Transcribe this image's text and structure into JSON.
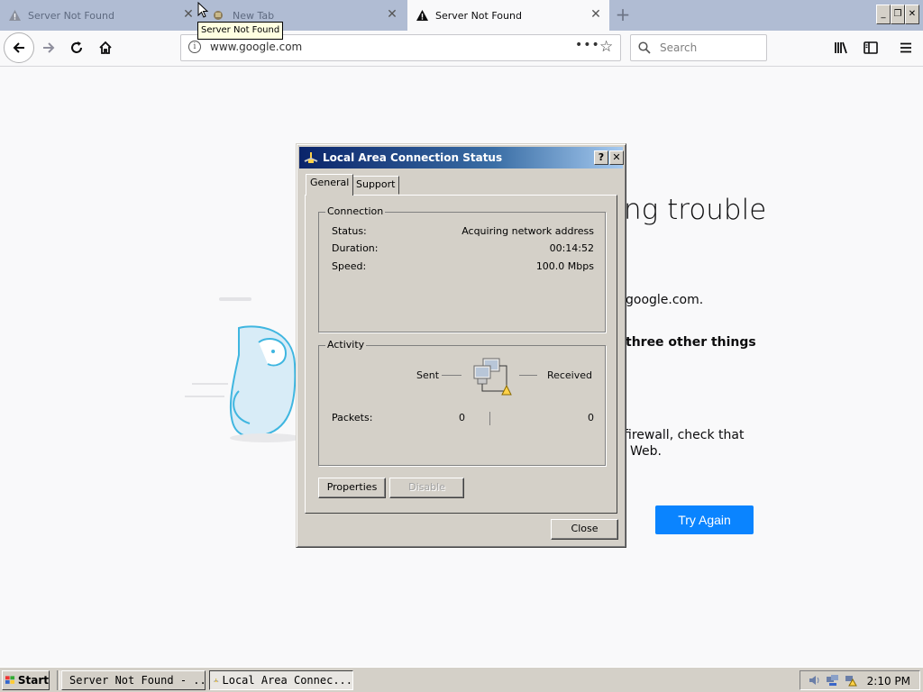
{
  "browser": {
    "tabs": [
      {
        "title": "Server Not Found",
        "state": "inactive"
      },
      {
        "title": "New Tab",
        "state": "inactive"
      },
      {
        "title": "Server Not Found",
        "state": "active"
      }
    ],
    "tooltip": "Server Not Found",
    "url": "www.google.com",
    "search_placeholder": "Search",
    "page_actions": "•••"
  },
  "error_page": {
    "title_fragment": "ng trouble",
    "line1_fragment": "google.com.",
    "heading_fragment": "three other things",
    "line2_fragment": "firewall, check that",
    "line3_fragment": "Web.",
    "try_again": "Try Again"
  },
  "dialog": {
    "title": "Local Area Connection Status",
    "help_glyph": "?",
    "close_glyph": "✕",
    "tabs": [
      "General",
      "Support"
    ],
    "connection": {
      "legend": "Connection",
      "rows": [
        {
          "label": "Status:",
          "value": "Acquiring network address"
        },
        {
          "label": "Duration:",
          "value": "00:14:52"
        },
        {
          "label": "Speed:",
          "value": "100.0 Mbps"
        }
      ]
    },
    "activity": {
      "legend": "Activity",
      "sent_label": "Sent",
      "received_label": "Received",
      "packets_label": "Packets:",
      "packets_sent": "0",
      "packets_received": "0"
    },
    "buttons": {
      "properties": "Properties",
      "disable": "Disable",
      "close": "Close"
    }
  },
  "taskbar": {
    "start": "Start",
    "tasks": [
      "Server Not Found - ...",
      "Local Area Connec..."
    ],
    "clock": "2:10 PM"
  },
  "colors": {
    "accent": "#0a84ff",
    "xp_face": "#d4d0c8",
    "titlebar": "#0a246a",
    "tabstrip": "#b0bcd3"
  }
}
